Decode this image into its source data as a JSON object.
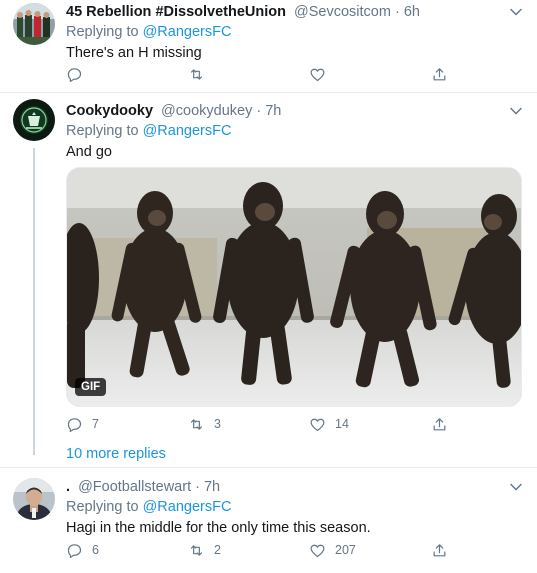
{
  "tweets": [
    {
      "name": "45 Rebellion #DissolvetheUnion",
      "handle": "@Sevcositcom",
      "time": "· 6h",
      "replying_prefix": "Replying to ",
      "replying_to": "@RangersFC",
      "text": "There's an H missing",
      "reply_count": "",
      "retweet_count": "",
      "like_count": ""
    },
    {
      "name": "Cookydooky",
      "handle": "@cookydukey",
      "time": "· 7h",
      "replying_prefix": "Replying to ",
      "replying_to": "@RangersFC",
      "text": "And go",
      "media_badge": "GIF",
      "reply_count": "7",
      "retweet_count": "3",
      "like_count": "14"
    },
    {
      "name": ".",
      "handle": "@Footballstewart",
      "time": "· 7h",
      "replying_prefix": "Replying to ",
      "replying_to": "@RangersFC",
      "text": "Hagi in the middle for the only time this season.",
      "reply_count": "6",
      "retweet_count": "2",
      "like_count": "207"
    }
  ],
  "more_replies": "10 more replies",
  "colors": {
    "accent": "#1b95e0",
    "secondary_text": "#657786",
    "divider": "#e6ecf0",
    "thread_line": "#ccd6dd"
  },
  "icons": [
    "reply-icon",
    "retweet-icon",
    "like-icon",
    "share-icon",
    "chevron-down-icon"
  ]
}
